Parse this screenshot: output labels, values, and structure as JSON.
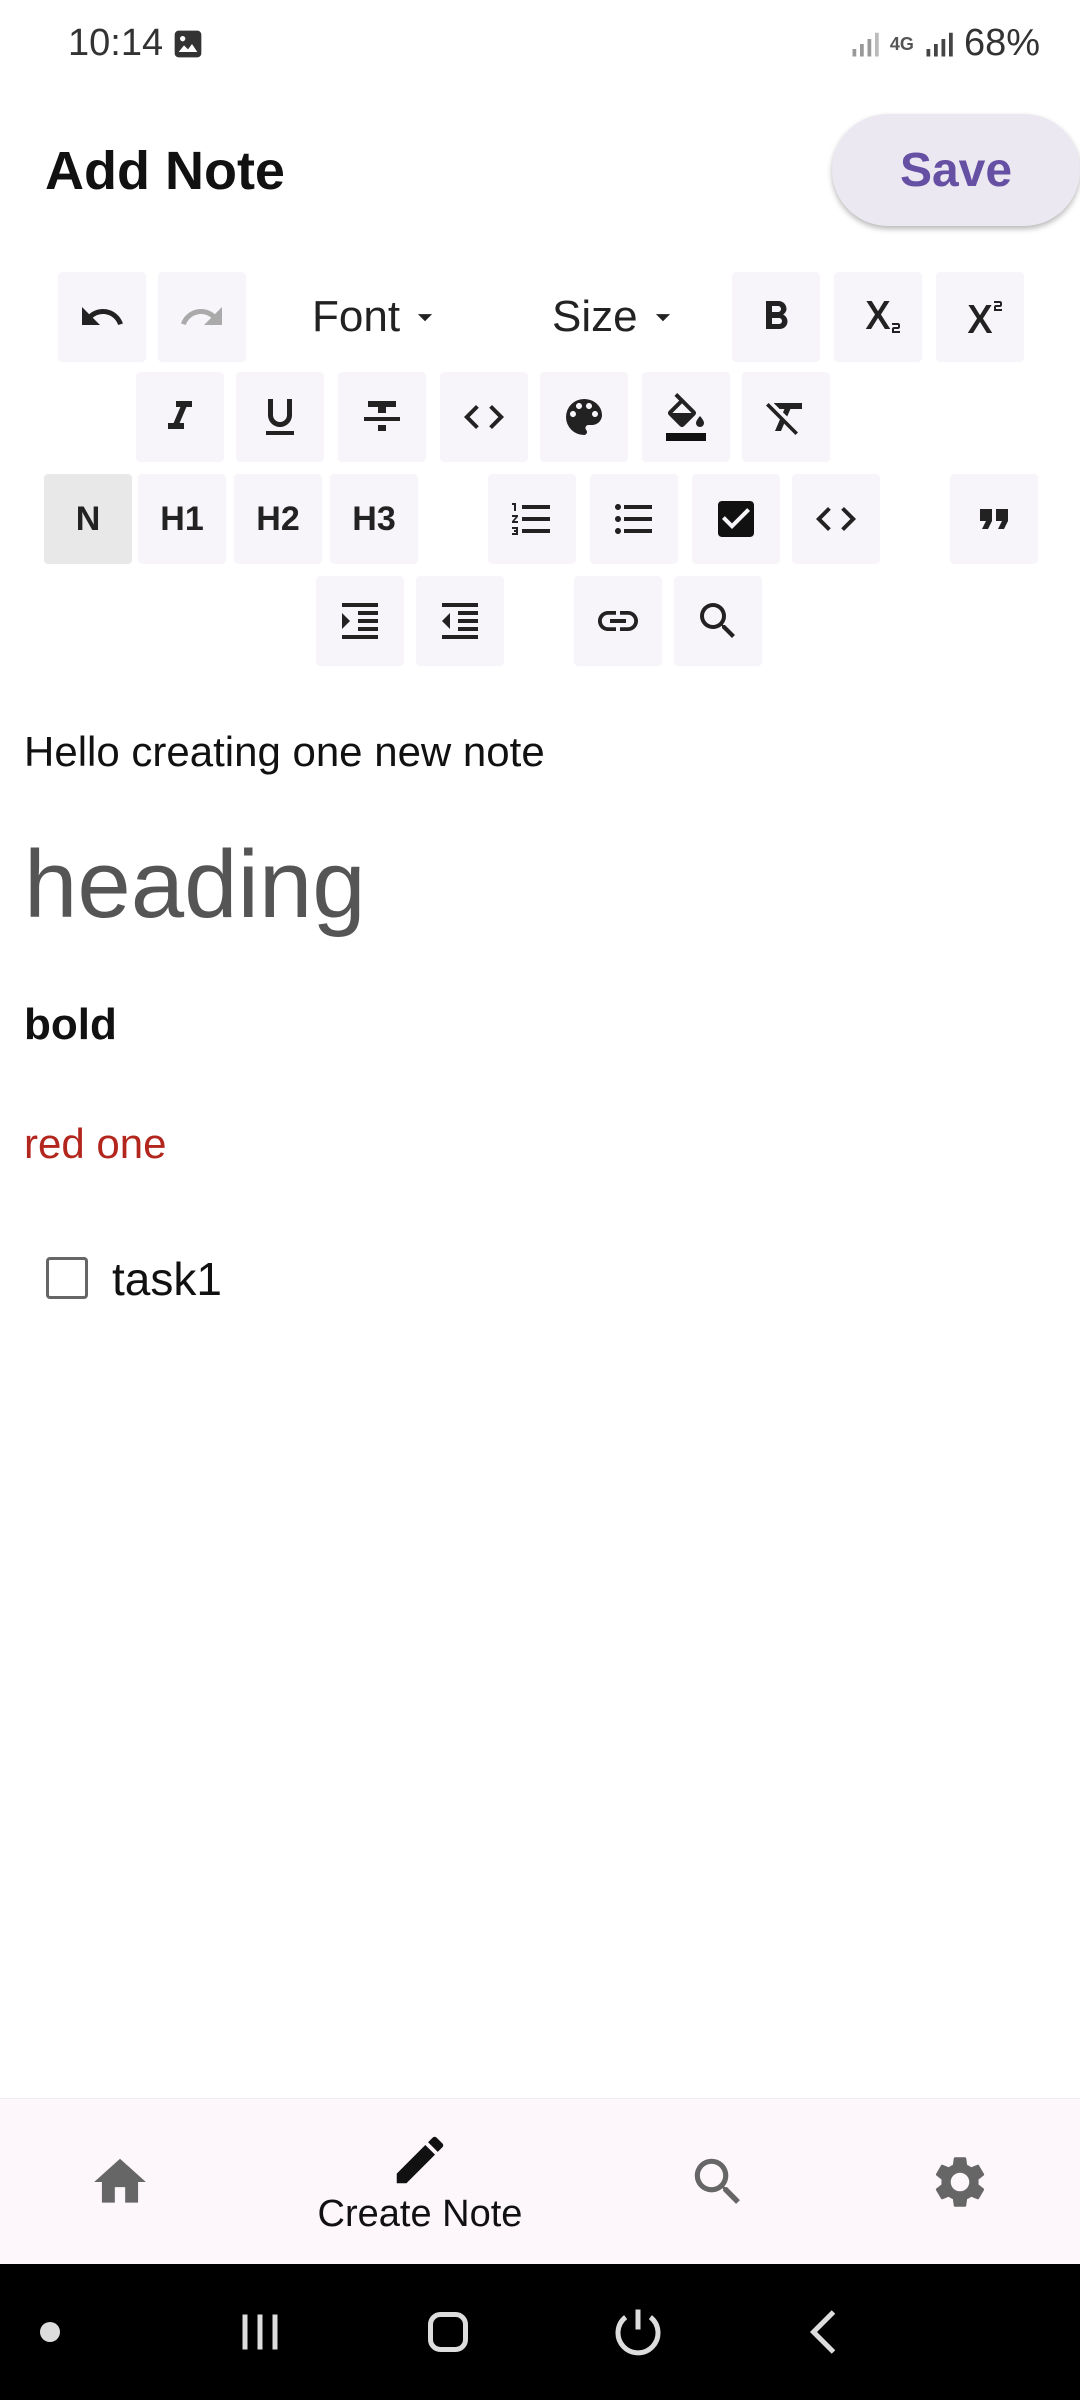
{
  "status": {
    "time": "10:14",
    "battery": "68%",
    "network": "4G"
  },
  "header": {
    "title": "Add Note",
    "save_label": "Save"
  },
  "toolbar": {
    "font_label": "Font",
    "size_label": "Size",
    "normal_label": "N",
    "h1_label": "H1",
    "h2_label": "H2",
    "h3_label": "H3",
    "selected_style": "N"
  },
  "editor": {
    "lines": [
      {
        "style": "normal",
        "text": "Hello creating one new note"
      },
      {
        "style": "heading",
        "text": "heading"
      },
      {
        "style": "bold",
        "text": "bold"
      },
      {
        "style": "red",
        "text": "red one",
        "color": "#b3261e"
      }
    ],
    "task": {
      "label": "task1",
      "checked": false
    }
  },
  "bottom_nav": {
    "items": [
      {
        "icon": "home-icon",
        "label": ""
      },
      {
        "icon": "pencil-icon",
        "label": "Create Note",
        "active": true
      },
      {
        "icon": "search-icon",
        "label": ""
      },
      {
        "icon": "gear-icon",
        "label": ""
      }
    ]
  },
  "colors": {
    "accent": "#6650a4",
    "save_bg": "#ebe8f1",
    "red_text": "#b3261e",
    "nav_bg": "#fdf7fc"
  }
}
